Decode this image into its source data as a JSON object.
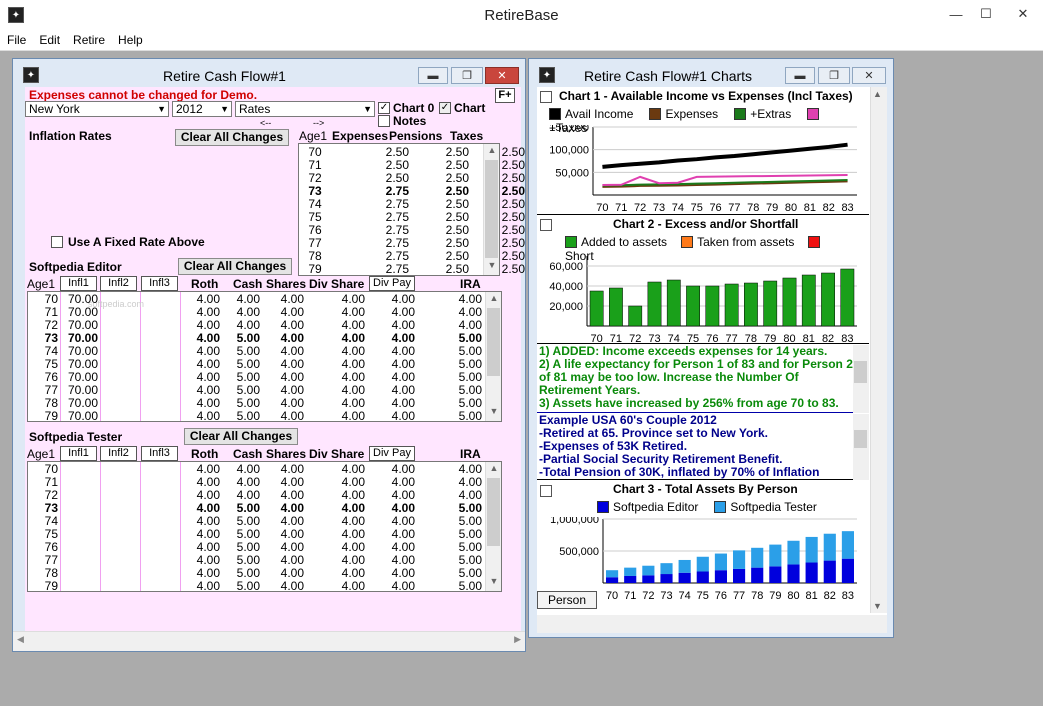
{
  "app": {
    "title": "RetireBase",
    "menu": [
      "File",
      "Edit",
      "Retire",
      "Help"
    ]
  },
  "left": {
    "title": "Retire Cash Flow#1",
    "warning": "Expenses cannot be changed for Demo.",
    "fplus": "F+",
    "state": "New York",
    "year": "2012",
    "rates": "Rates",
    "chart0": "Chart 0",
    "chart": "Chart",
    "notes": "Notes",
    "inflation_label": "Inflation Rates",
    "clear_all": "Clear All Changes",
    "arrows": [
      "<--",
      "-->"
    ],
    "infl_headers": [
      "Age1",
      "Expenses",
      "Pensions",
      "Taxes"
    ],
    "infl_rows": [
      [
        "70",
        "2.50",
        "2.50",
        "2.50"
      ],
      [
        "71",
        "2.50",
        "2.50",
        "2.50"
      ],
      [
        "72",
        "2.50",
        "2.50",
        "2.50"
      ],
      [
        "73",
        "2.75",
        "2.50",
        "2.50"
      ],
      [
        "74",
        "2.75",
        "2.50",
        "2.50"
      ],
      [
        "75",
        "2.75",
        "2.50",
        "2.50"
      ],
      [
        "76",
        "2.75",
        "2.50",
        "2.50"
      ],
      [
        "77",
        "2.75",
        "2.50",
        "2.50"
      ],
      [
        "78",
        "2.75",
        "2.50",
        "2.50"
      ],
      [
        "79",
        "2.75",
        "2.50",
        "2.50"
      ]
    ],
    "fixed_rate": "Use A Fixed Rate Above",
    "persons": [
      {
        "name": "Softpedia Editor",
        "watermark": "softpedia.com",
        "ira": [
          "4.00",
          "4.00",
          "4.00",
          "5.00",
          "5.00",
          "5.00",
          "5.00",
          "5.00",
          "5.00",
          "5.00"
        ],
        "infl1": [
          "70.00",
          "70.00",
          "70.00",
          "70.00",
          "70.00",
          "70.00",
          "70.00",
          "70.00",
          "70.00",
          "70.00"
        ]
      },
      {
        "name": "Softpedia Tester",
        "ira": [
          "4.00",
          "4.00",
          "4.00",
          "5.00",
          "5.00",
          "5.00",
          "5.00",
          "5.00",
          "5.00",
          "5.00"
        ],
        "infl1": [
          "",
          "",
          "",
          "",
          "",
          "",
          "",
          "",
          "",
          ""
        ]
      }
    ],
    "person_headers": [
      "Age1",
      "Infl1",
      "Infl2",
      "Infl3",
      "Roth",
      "Cash",
      "Shares",
      "Div Share",
      "Div Pay",
      "IRA"
    ],
    "ages": [
      "70",
      "71",
      "72",
      "73",
      "74",
      "75",
      "76",
      "77",
      "78",
      "79"
    ],
    "roth": [
      "4.00",
      "4.00",
      "4.00",
      "4.00",
      "4.00",
      "4.00",
      "4.00",
      "4.00",
      "4.00",
      "4.00"
    ],
    "cash": [
      "4.00",
      "4.00",
      "4.00",
      "5.00",
      "5.00",
      "5.00",
      "5.00",
      "5.00",
      "5.00",
      "5.00"
    ],
    "shares": [
      "4.00",
      "4.00",
      "4.00",
      "4.00",
      "4.00",
      "4.00",
      "4.00",
      "4.00",
      "4.00",
      "4.00"
    ],
    "divshare": [
      "4.00",
      "4.00",
      "4.00",
      "4.00",
      "4.00",
      "4.00",
      "4.00",
      "4.00",
      "4.00",
      "4.00"
    ],
    "divpay": [
      "4.00",
      "4.00",
      "4.00",
      "4.00",
      "4.00",
      "4.00",
      "4.00",
      "4.00",
      "4.00",
      "4.00"
    ]
  },
  "right": {
    "title": "Retire Cash Flow#1 Charts",
    "chart1_title": "Chart 1 - Available Income vs Expenses (Incl Taxes)",
    "chart2_title": "Chart 2 - Excess and/or Shortfall",
    "chart3_title": "Chart 3 - Total Assets By Person",
    "person_tab": "Person",
    "notes1": [
      "1) ADDED: Income exceeds expenses for 14 years.",
      "2) A life expectancy for Person 1 of 83 and for Person 2 of 81 may be too low. Increase the Number Of Retirement Years.",
      "3) Assets have increased by 256% from age 70 to 83."
    ],
    "notes2": [
      "Example USA 60's Couple 2012",
      "-Retired at 65. Province set to New York.",
      "-Expenses of 53K Retired.",
      "-Partial Social Security Retirement Benefit.",
      "-Total Pension of 30K, inflated by 70% of Inflation"
    ]
  },
  "chart_data": [
    {
      "type": "line",
      "title": "Chart 1 - Available Income vs Expenses (Incl Taxes)",
      "x": [
        70,
        71,
        72,
        73,
        74,
        75,
        76,
        77,
        78,
        79,
        80,
        81,
        82,
        83
      ],
      "ylim": [
        0,
        150000
      ],
      "yticks": [
        "150,000",
        "100,000",
        "50,000"
      ],
      "series": [
        {
          "name": "Avail Income",
          "color": "#000000",
          "values": [
            62000,
            66000,
            69000,
            72000,
            76000,
            79000,
            83000,
            86000,
            90000,
            94000,
            98000,
            102000,
            106000,
            111000
          ]
        },
        {
          "name": "Expenses",
          "color": "#6b3a10",
          "values": [
            18000,
            18500,
            20000,
            20500,
            21000,
            22000,
            23000,
            24000,
            25000,
            26000,
            27000,
            28000,
            29000,
            30000
          ]
        },
        {
          "name": "+Extras",
          "color": "#1b7a1b",
          "values": [
            21000,
            21500,
            23000,
            23500,
            24000,
            25000,
            26000,
            27000,
            28000,
            29000,
            30000,
            31000,
            32000,
            33000
          ]
        },
        {
          "name": "+Taxes",
          "color": "#e040b0",
          "values": [
            22000,
            22500,
            40000,
            26000,
            27000,
            40000,
            40500,
            41000,
            41500,
            42000,
            42500,
            43000,
            43500,
            44000
          ]
        }
      ]
    },
    {
      "type": "bar",
      "title": "Chart 2 - Excess and/or Shortfall",
      "categories": [
        "70",
        "71",
        "72",
        "73",
        "74",
        "75",
        "76",
        "77",
        "78",
        "79",
        "80",
        "81",
        "82",
        "83"
      ],
      "ylim": [
        0,
        70000
      ],
      "yticks": [
        "60,000",
        "40,000",
        "20,000"
      ],
      "series": [
        {
          "name": "Added to assets",
          "color": "#1aa01a",
          "values": [
            35000,
            38000,
            20000,
            44000,
            46000,
            40000,
            40000,
            42000,
            43000,
            45000,
            48000,
            51000,
            53000,
            57000
          ]
        },
        {
          "name": "Taken from assets",
          "color": "#ff7a1a",
          "values": []
        },
        {
          "name": "Short",
          "color": "#ee1111",
          "values": []
        }
      ]
    },
    {
      "type": "bar",
      "title": "Chart 3 - Total Assets By Person",
      "categories": [
        "70",
        "71",
        "72",
        "73",
        "74",
        "75",
        "76",
        "77",
        "78",
        "79",
        "80",
        "81",
        "82",
        "83"
      ],
      "ylim": [
        0,
        1000000
      ],
      "yticks": [
        "1,000,000",
        "500,000"
      ],
      "series": [
        {
          "name": "Softpedia Editor",
          "color": "#0000dd",
          "values": [
            90000,
            110000,
            120000,
            140000,
            160000,
            180000,
            200000,
            220000,
            240000,
            260000,
            290000,
            320000,
            350000,
            380000
          ]
        },
        {
          "name": "Softpedia Tester",
          "color": "#2b9fe8",
          "values": [
            110000,
            130000,
            150000,
            170000,
            200000,
            230000,
            260000,
            290000,
            310000,
            340000,
            370000,
            400000,
            420000,
            430000
          ]
        }
      ]
    }
  ]
}
